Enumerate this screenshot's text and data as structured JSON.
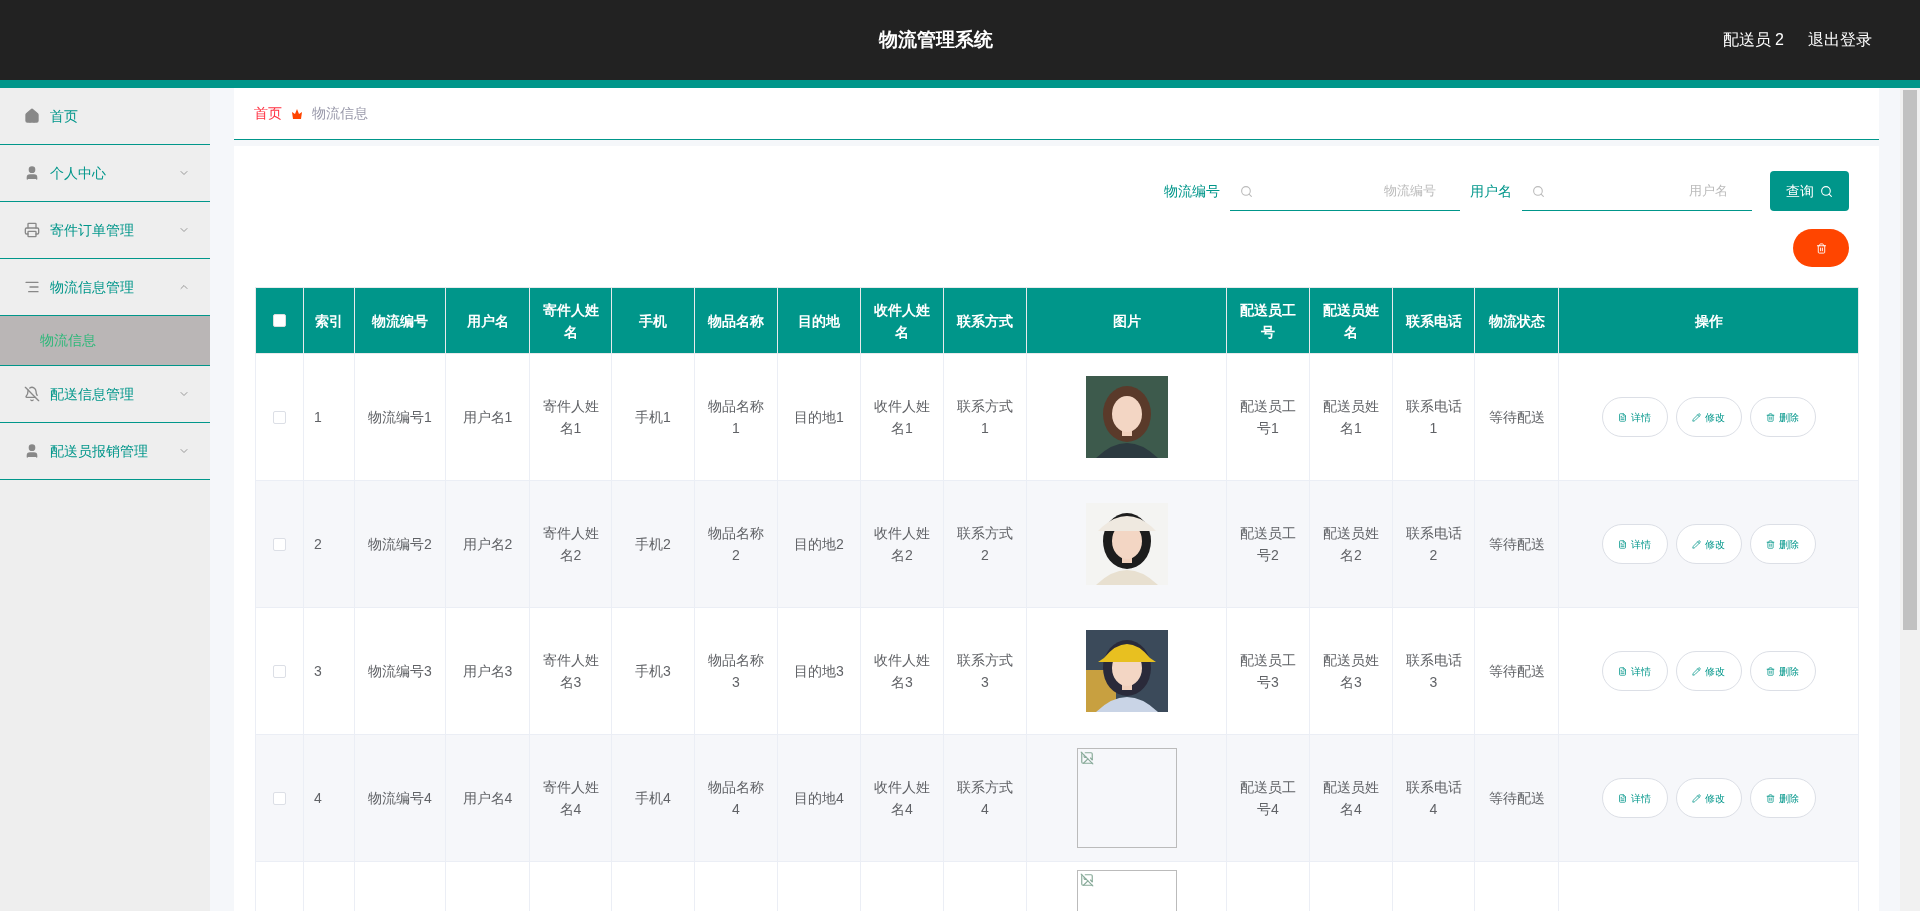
{
  "header": {
    "title": "物流管理系统",
    "user": "配送员 2",
    "logout": "退出登录"
  },
  "sidebar": {
    "items": [
      {
        "label": "首页",
        "kind": "link"
      },
      {
        "label": "个人中心",
        "kind": "menu",
        "expanded": false
      },
      {
        "label": "寄件订单管理",
        "kind": "menu",
        "expanded": false
      },
      {
        "label": "物流信息管理",
        "kind": "menu",
        "expanded": true,
        "children": [
          {
            "label": "物流信息",
            "selected": true
          }
        ]
      },
      {
        "label": "配送信息管理",
        "kind": "menu",
        "expanded": false
      },
      {
        "label": "配送员报销管理",
        "kind": "menu",
        "expanded": false
      }
    ]
  },
  "breadcrumb": [
    "首页",
    "物流信息"
  ],
  "search": {
    "fields": [
      {
        "label": "物流编号",
        "placeholder": "物流编号"
      },
      {
        "label": "用户名",
        "placeholder": "用户名"
      }
    ],
    "button": "查询"
  },
  "table": {
    "select_all": {
      "checked": false
    },
    "columns": [
      "索引",
      "物流编号",
      "用户名",
      "寄件人姓名",
      "手机",
      "物品名称",
      "目的地",
      "收件人姓名",
      "联系方式",
      "图片",
      "配送员工号",
      "配送员姓名",
      "联系电话",
      "物流状态",
      "操作"
    ],
    "rows": [
      {
        "checked": false,
        "cells": [
          "1",
          "物流编号1",
          "用户名1",
          "寄件人姓名1",
          "手机1",
          "物品名称1",
          "目的地1",
          "收件人姓名1",
          "联系方式1"
        ],
        "image": {
          "kind": "picture"
        },
        "cells_after": [
          "配送员工号1",
          "配送员姓名1",
          "联系电话1",
          "等待配送"
        ],
        "actions": [
          "详情",
          "修改",
          "删除"
        ]
      },
      {
        "checked": false,
        "cells": [
          "2",
          "物流编号2",
          "用户名2",
          "寄件人姓名2",
          "手机2",
          "物品名称2",
          "目的地2",
          "收件人姓名2",
          "联系方式2"
        ],
        "image": {
          "kind": "picture"
        },
        "cells_after": [
          "配送员工号2",
          "配送员姓名2",
          "联系电话2",
          "等待配送"
        ],
        "actions": [
          "详情",
          "修改",
          "删除"
        ]
      },
      {
        "checked": false,
        "cells": [
          "3",
          "物流编号3",
          "用户名3",
          "寄件人姓名3",
          "手机3",
          "物品名称3",
          "目的地3",
          "收件人姓名3",
          "联系方式3"
        ],
        "image": {
          "kind": "picture"
        },
        "cells_after": [
          "配送员工号3",
          "配送员姓名3",
          "联系电话3",
          "等待配送"
        ],
        "actions": [
          "详情",
          "修改",
          "删除"
        ]
      },
      {
        "checked": false,
        "cells": [
          "4",
          "物流编号4",
          "用户名4",
          "寄件人姓名4",
          "手机4",
          "物品名称4",
          "目的地4",
          "收件人姓名4",
          "联系方式4"
        ],
        "image": {
          "kind": "broken"
        },
        "cells_after": [
          "配送员工号4",
          "配送员姓名4",
          "联系电话4",
          "等待配送"
        ],
        "actions": [
          "详情",
          "修改",
          "删除"
        ]
      },
      {
        "image": {
          "kind": "broken"
        }
      }
    ]
  }
}
